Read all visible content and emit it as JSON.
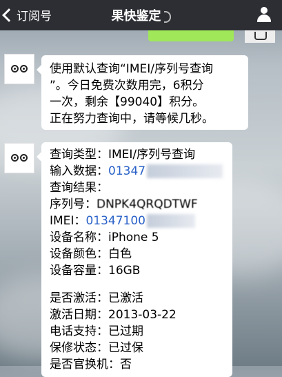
{
  "nav": {
    "back_label": "订阅号",
    "title": "果快鉴定"
  },
  "message1": {
    "lines": [
      "使用默认查询“IMEI/序列号查询",
      "”。今日免费次数用完，6积分",
      "一次，剩余【99040】积分。",
      "正在努力查询中，请等候几秒。"
    ]
  },
  "message2": {
    "query_type": "查询类型：IMEI/序列号查询",
    "input_label": "输入数据：",
    "input_value": "01347",
    "result_label": "查询结果：",
    "serial_label": "序列号：",
    "serial_value": "DNPK4QRQDTWF",
    "imei_label": "IMEI：",
    "imei_value": "01347100",
    "device_name": "设备名称：iPhone 5",
    "device_color": "设备颜色：白色",
    "device_capacity": "设备容量：16GB",
    "activated": "是否激活：已激活",
    "activation_date": "激活日期：2013-03-22",
    "phone_support": "电话支持：已过期",
    "warranty": "保修状态：已过保",
    "replaced": "是否官换机：否"
  }
}
